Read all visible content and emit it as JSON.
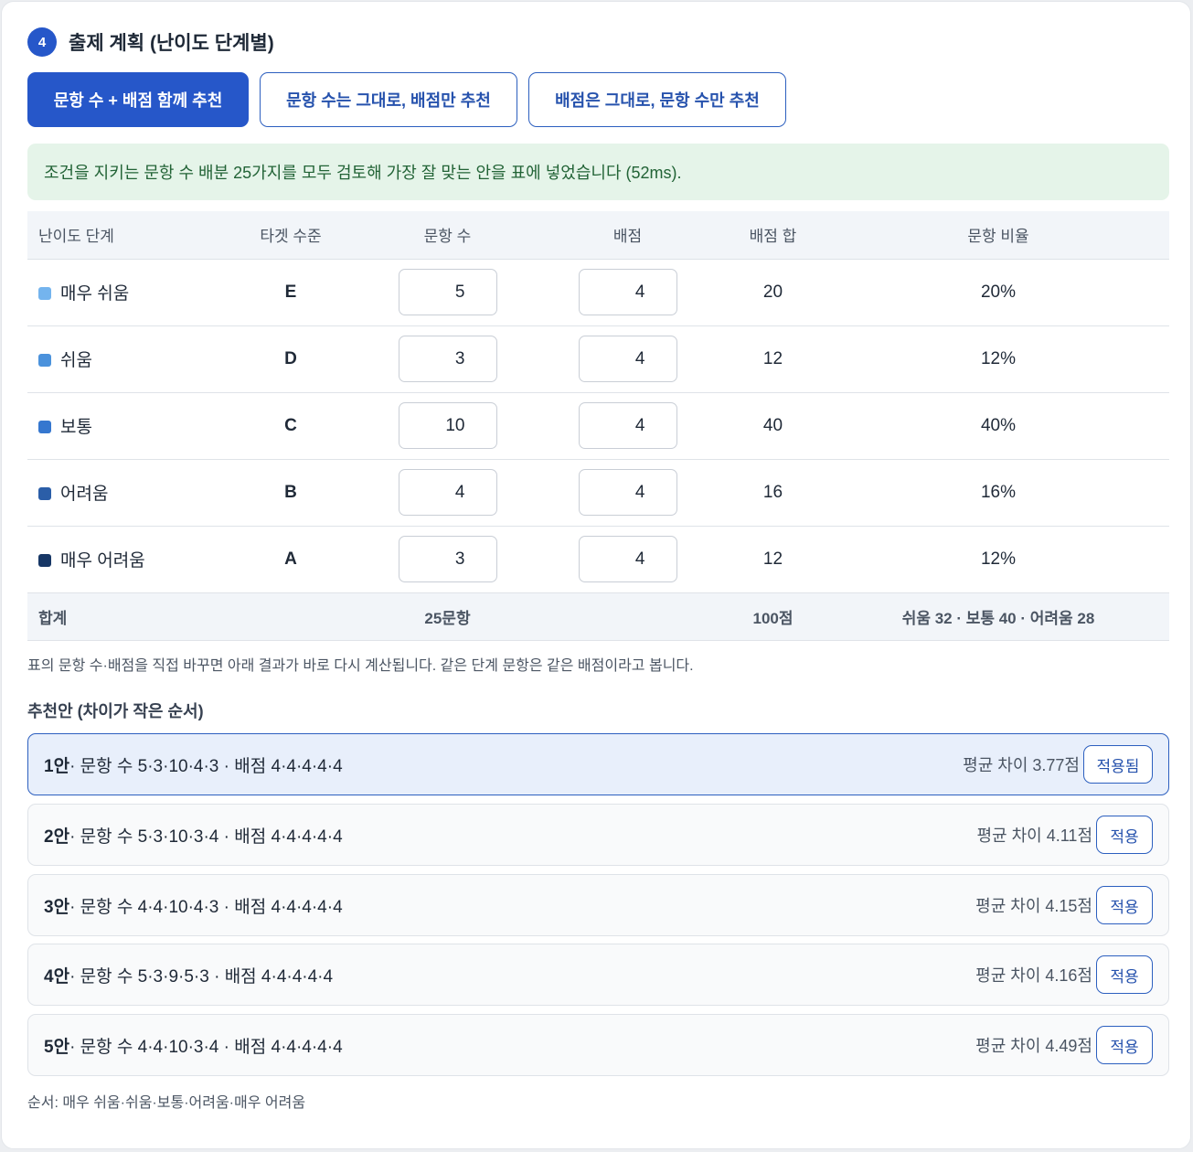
{
  "section": {
    "step": "4",
    "title": "출제 계획 (난이도 단계별)"
  },
  "modes": [
    {
      "label": "문항 수 + 배점 함께 추천",
      "active": true
    },
    {
      "label": "문항 수는 그대로, 배점만 추천",
      "active": false
    },
    {
      "label": "배점은 그대로, 문항 수만 추천",
      "active": false
    }
  ],
  "notice": "조건을 지키는 문항 수 배분 25가지를 모두 검토해 가장 잘 맞는 안을 표에 넣었습니다 (52ms).",
  "table": {
    "headers": [
      "난이도 단계",
      "타겟 수준",
      "문항 수",
      "배점",
      "배점 합",
      "문항 비율"
    ],
    "rows": [
      {
        "level": "매우 쉬움",
        "color": "#74b4ee",
        "target": "E",
        "count": "5",
        "score": "4",
        "sum": "20",
        "ratio": "20%"
      },
      {
        "level": "쉬움",
        "color": "#4b92dc",
        "target": "D",
        "count": "3",
        "score": "4",
        "sum": "12",
        "ratio": "12%"
      },
      {
        "level": "보통",
        "color": "#3577cf",
        "target": "C",
        "count": "10",
        "score": "4",
        "sum": "40",
        "ratio": "40%"
      },
      {
        "level": "어려움",
        "color": "#2b5ea8",
        "target": "B",
        "count": "4",
        "score": "4",
        "sum": "16",
        "ratio": "16%"
      },
      {
        "level": "매우 어려움",
        "color": "#173766",
        "target": "A",
        "count": "3",
        "score": "4",
        "sum": "12",
        "ratio": "12%"
      }
    ],
    "footer": {
      "label": "합계",
      "count_total": "25문항",
      "sum_total": "100점",
      "distribution": "쉬움 32 · 보통 40 · 어려움 28"
    }
  },
  "note": "표의 문항 수·배점을 직접 바꾸면 아래 결과가 바로 다시 계산됩니다. 같은 단계 문항은 같은 배점이라고 봅니다.",
  "recommendations": {
    "title": "추천안 (차이가 작은 순서)",
    "items": [
      {
        "rank": "1안",
        "desc": " · 문항 수 5·3·10·4·3 · 배점 4·4·4·4·4",
        "diff": "평균 차이 3.77점",
        "button": "적용됨",
        "selected": true
      },
      {
        "rank": "2안",
        "desc": " · 문항 수 5·3·10·3·4 · 배점 4·4·4·4·4",
        "diff": "평균 차이 4.11점",
        "button": "적용",
        "selected": false
      },
      {
        "rank": "3안",
        "desc": " · 문항 수 4·4·10·4·3 · 배점 4·4·4·4·4",
        "diff": "평균 차이 4.15점",
        "button": "적용",
        "selected": false
      },
      {
        "rank": "4안",
        "desc": " · 문항 수 5·3·9·5·3 · 배점 4·4·4·4·4",
        "diff": "평균 차이 4.16점",
        "button": "적용",
        "selected": false
      },
      {
        "rank": "5안",
        "desc": " · 문항 수 4·4·10·3·4 · 배점 4·4·4·4·4",
        "diff": "평균 차이 4.49점",
        "button": "적용",
        "selected": false
      }
    ]
  },
  "order_note": "순서: 매우 쉬움·쉬움·보통·어려움·매우 어려움"
}
